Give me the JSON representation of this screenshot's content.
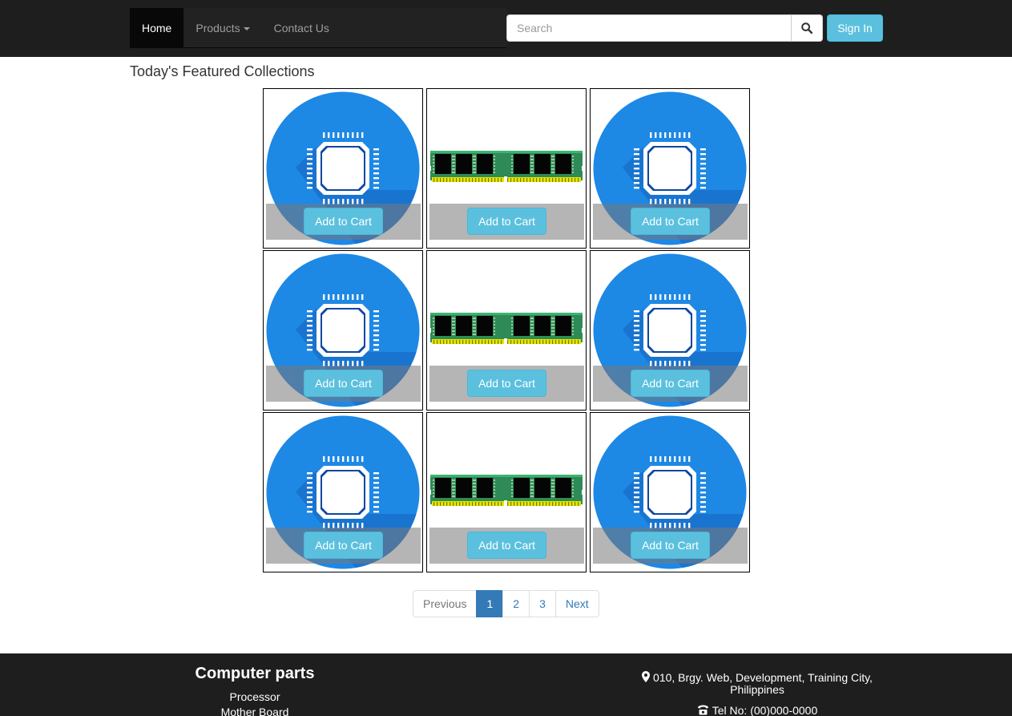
{
  "navbar": {
    "home_label": "Home",
    "products_label": "Products",
    "contact_label": "Contact Us",
    "search_placeholder": "Search",
    "search_value": "",
    "signin_label": "Sign In"
  },
  "heading": "Today's Featured Collections",
  "products": [
    {
      "image": "cpu-chip-icon",
      "button_label": "Add to Cart"
    },
    {
      "image": "ram-module-image",
      "button_label": "Add to Cart"
    },
    {
      "image": "cpu-chip-icon",
      "button_label": "Add to Cart"
    },
    {
      "image": "cpu-chip-icon",
      "button_label": "Add to Cart"
    },
    {
      "image": "ram-module-image",
      "button_label": "Add to Cart"
    },
    {
      "image": "cpu-chip-icon",
      "button_label": "Add to Cart"
    },
    {
      "image": "cpu-chip-icon",
      "button_label": "Add to Cart"
    },
    {
      "image": "ram-module-image",
      "button_label": "Add to Cart"
    },
    {
      "image": "cpu-chip-icon",
      "button_label": "Add to Cart"
    }
  ],
  "pagination": {
    "previous": "Previous",
    "pages": [
      "1",
      "2",
      "3"
    ],
    "active_page": "1",
    "next": "Next"
  },
  "footer": {
    "title": "Computer parts",
    "links": [
      "Processor",
      "Mother Board"
    ],
    "address": "010, Brgy. Web, Development, Training City, Philippines",
    "tel": "Tel No: (00)000-0000"
  },
  "colors": {
    "navbar_bg": "#1e1e1e",
    "accent_info": "#5bc0de",
    "pagination_active": "#337ab7",
    "chip_blue": "#1e88e5"
  }
}
